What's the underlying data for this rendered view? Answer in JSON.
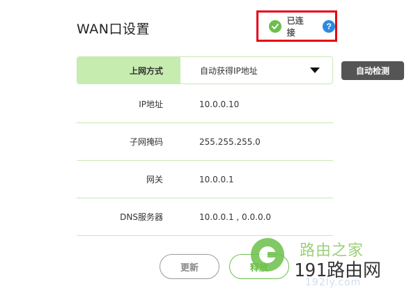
{
  "header": {
    "title": "WAN口设置"
  },
  "status": {
    "text": "已连接",
    "help_glyph": "?",
    "accent_color": "#e60012",
    "ok_color": "#6cc04a",
    "help_color": "#2d8ae0"
  },
  "connection_type": {
    "label": "上网方式",
    "value": "自动获得IP地址"
  },
  "auto_detect_label": "自动检测",
  "info": [
    {
      "label": "IP地址",
      "value": "10.0.0.10"
    },
    {
      "label": "子网掩码",
      "value": "255.255.255.0"
    },
    {
      "label": "网关",
      "value": "10.0.0.1"
    },
    {
      "label": "DNS服务器",
      "value": "10.0.0.1 , 0.0.0.0"
    }
  ],
  "actions": {
    "refresh_label": "更新",
    "release_label": "释放"
  },
  "watermark": {
    "top_text": "路由之家",
    "main_digits": "191",
    "main_text": "路由网",
    "url": "192ly.com"
  }
}
